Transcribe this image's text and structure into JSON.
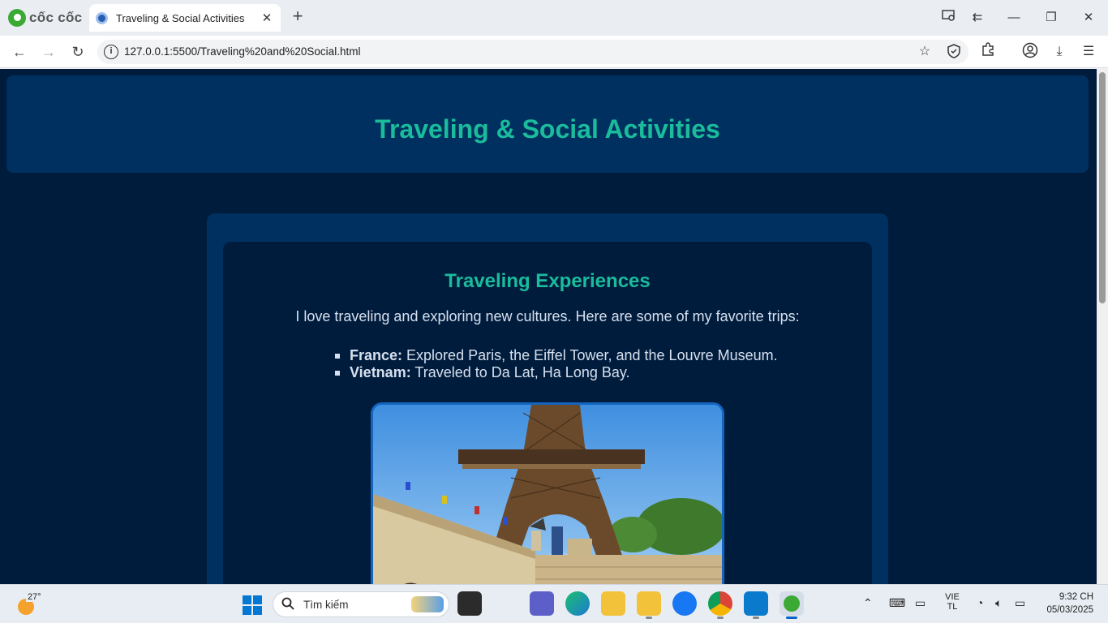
{
  "browser": {
    "brand": "cốc cốc",
    "tab_title": "Traveling & Social Activities",
    "tab_close": "✕",
    "new_tab": "+",
    "url": "127.0.0.1:5500/Traveling%20and%20Social.html",
    "url_info_glyph": "i"
  },
  "page": {
    "header_title": "Traveling & Social Activities",
    "section_title": "Traveling Experiences",
    "intro": "I love traveling and exploring new cultures. Here are some of my favorite trips:",
    "trips": [
      {
        "place": "France:",
        "text": " Explored Paris, the Eiffel Tower, and the Louvre Museum."
      },
      {
        "place": "Vietnam:",
        "text": " Traveled to Da Lat, Ha Long Bay."
      }
    ],
    "colors": {
      "accent": "#1abc9c",
      "bg": "#001c3d",
      "panel": "#00305f",
      "frame": "#1565c0"
    }
  },
  "taskbar": {
    "weather_temp": "27°",
    "search_placeholder": "Tìm kiếm",
    "lang_top": "VIE",
    "lang_bottom": "TL",
    "time": "9:32 CH",
    "date": "05/03/2025"
  }
}
